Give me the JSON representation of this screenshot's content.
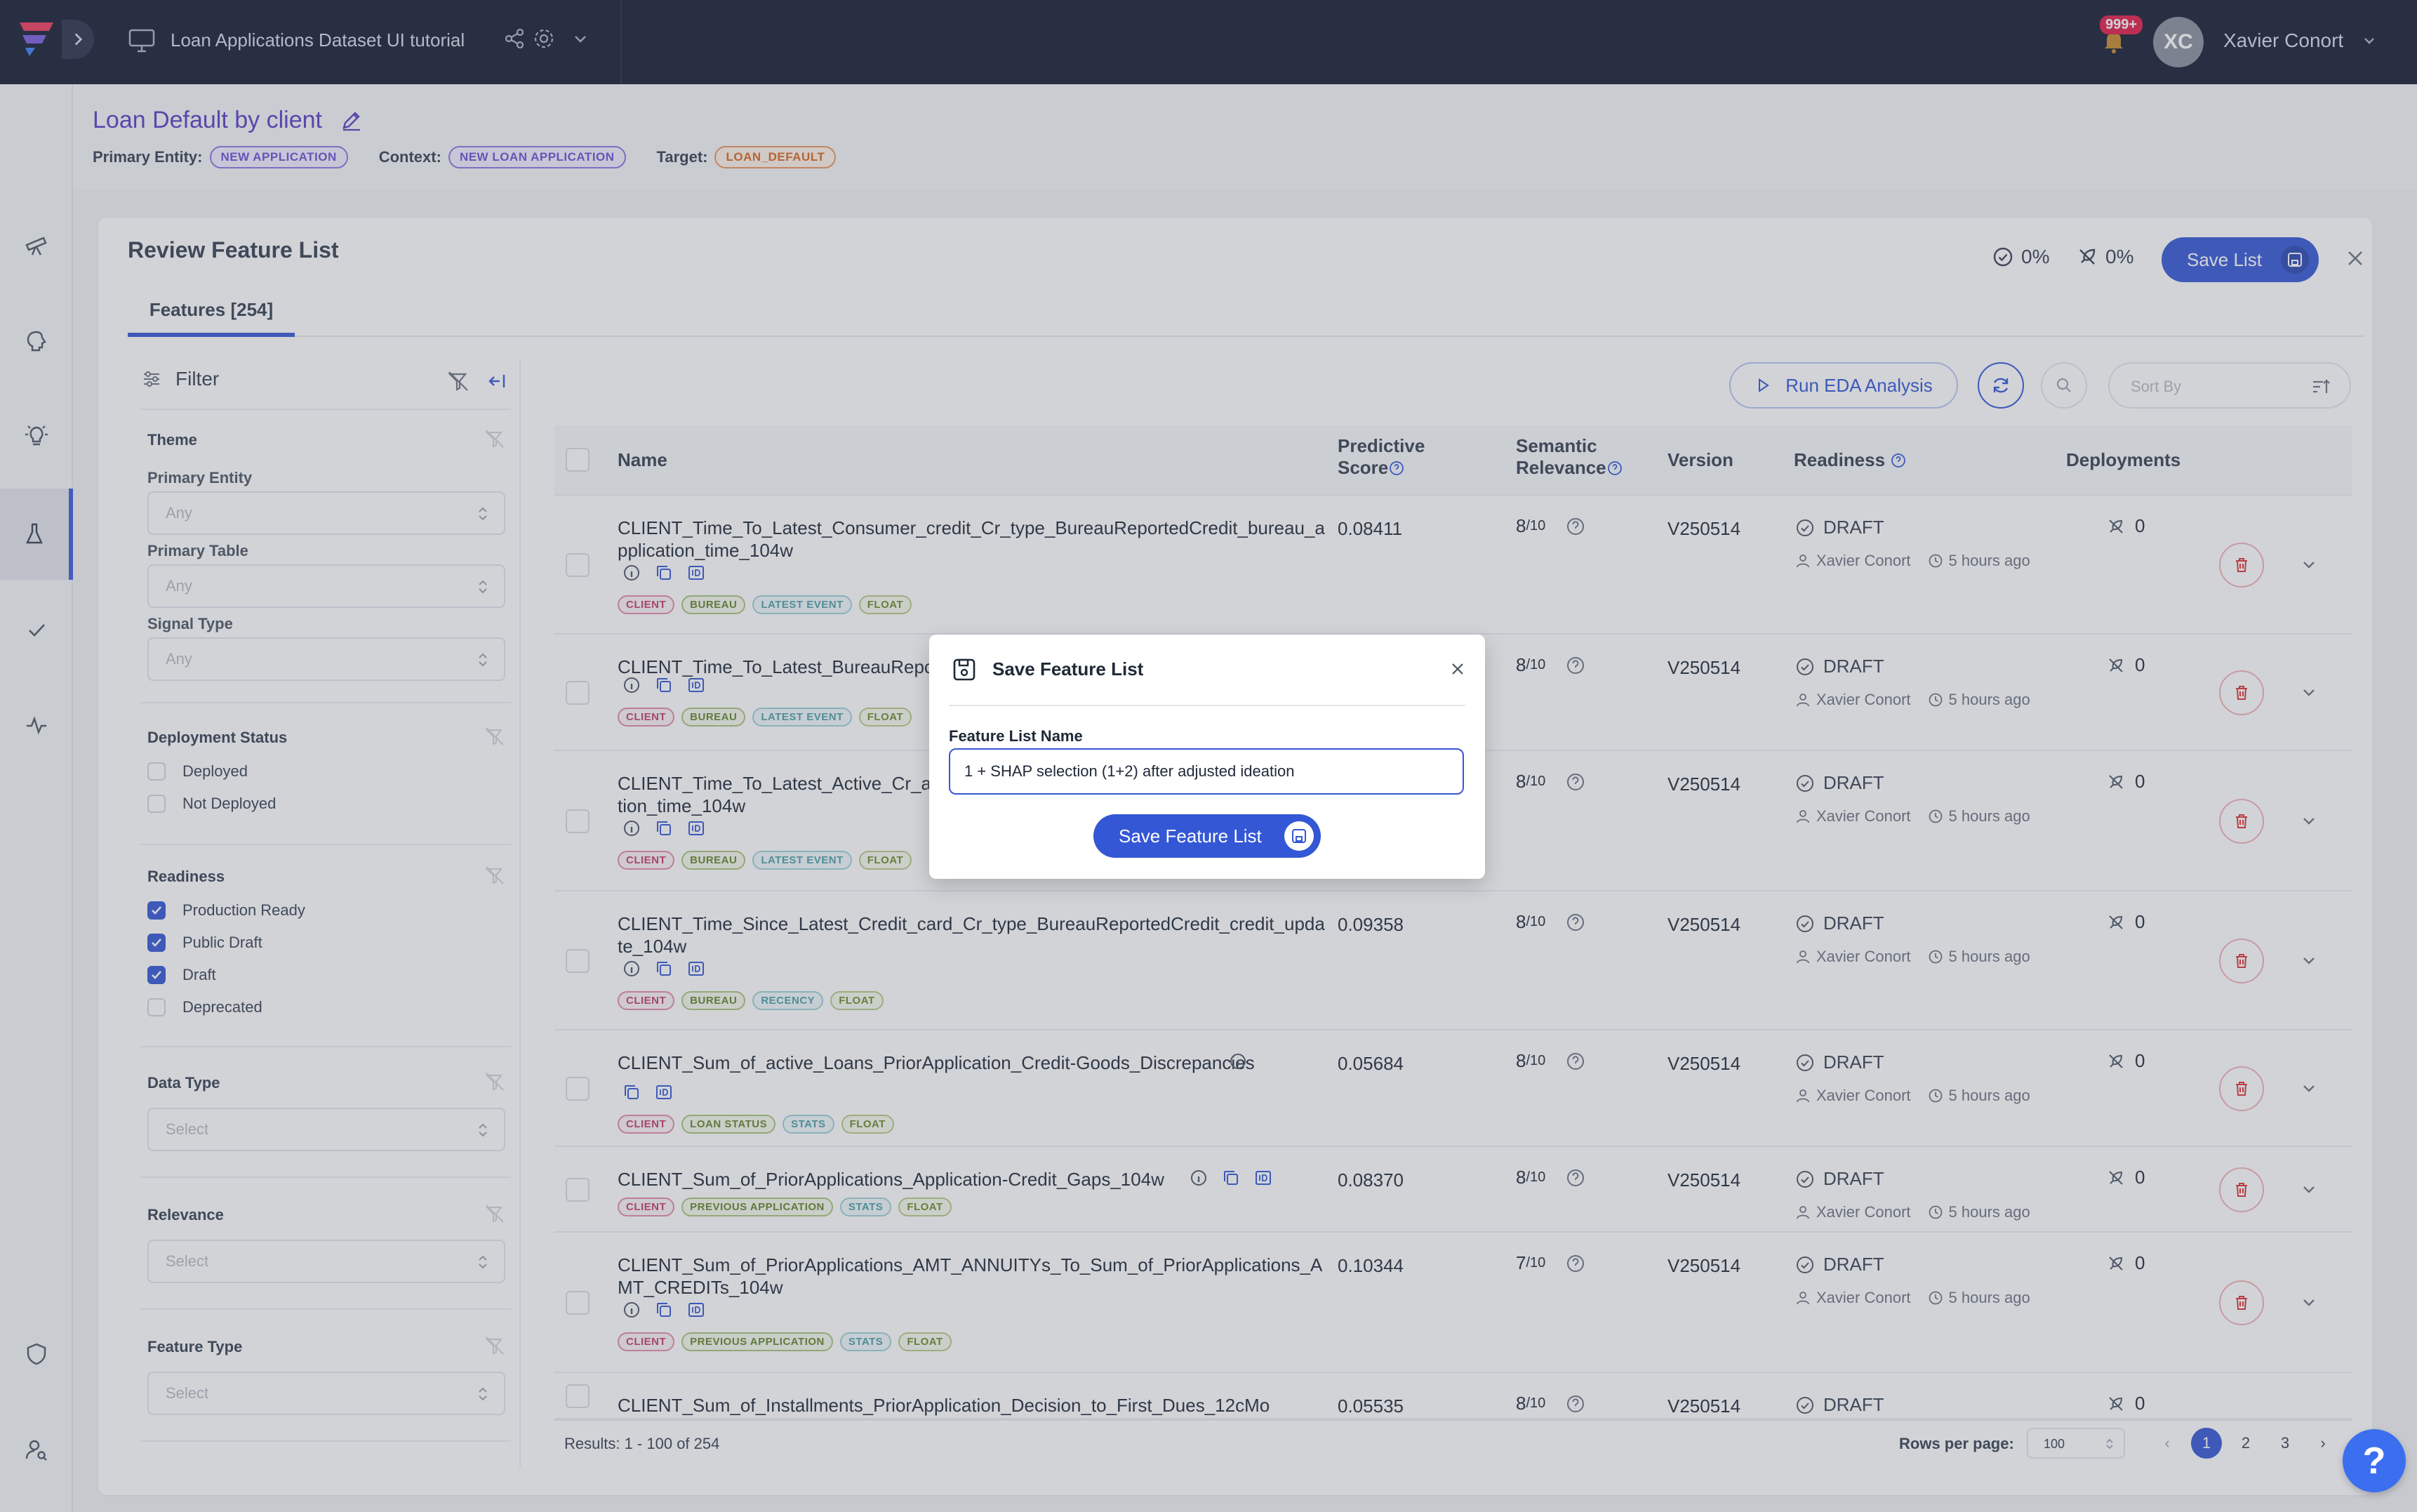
{
  "topbar": {
    "workspace_title": "Loan Applications Dataset UI tutorial",
    "notif_count": "999+",
    "avatar_initials": "XC",
    "user_name": "Xavier Conort"
  },
  "header": {
    "title": "Loan Default by client",
    "primary_entity_label": "Primary Entity:",
    "primary_entity": "NEW APPLICATION",
    "context_label": "Context:",
    "context": "NEW LOAN APPLICATION",
    "target_label": "Target:",
    "target": "LOAN_DEFAULT"
  },
  "card": {
    "title": "Review Feature List",
    "pct_ready": "0%",
    "pct_deployed": "0%",
    "save_list_label": "Save List",
    "tab_features": "Features [254]"
  },
  "filter": {
    "title": "Filter",
    "theme": "Theme",
    "primary_entity": "Primary Entity",
    "primary_table": "Primary Table",
    "signal_type": "Signal Type",
    "any": "Any",
    "deployment_status": "Deployment Status",
    "deployed": "Deployed",
    "not_deployed": "Not Deployed",
    "readiness": "Readiness",
    "production_ready": "Production Ready",
    "public_draft": "Public Draft",
    "draft": "Draft",
    "deprecated": "Deprecated",
    "data_type": "Data Type",
    "relevance": "Relevance",
    "feature_type": "Feature Type",
    "select": "Select"
  },
  "toolbar": {
    "run_eda": "Run EDA Analysis",
    "sort_by": "Sort By"
  },
  "table": {
    "col_name": "Name",
    "col_score_1": "Predictive",
    "col_score_2": "Score",
    "col_rel_1": "Semantic",
    "col_rel_2": "Relevance",
    "col_version": "Version",
    "col_readiness": "Readiness",
    "col_deployments": "Deployments",
    "rows": [
      {
        "name": "CLIENT_Time_To_Latest_Consumer_credit_Cr_type_BureauReportedCredit_bureau_application_time_104w",
        "score": "0.08411",
        "rel": "8",
        "ver": "V250514",
        "chips": [
          "CLIENT",
          "BUREAU",
          "LATEST EVENT",
          "FLOAT"
        ]
      },
      {
        "name": "CLIENT_Time_To_Latest_BureauRepc",
        "score": "",
        "rel": "8",
        "ver": "V250514",
        "chips": [
          "CLIENT",
          "BUREAU",
          "LATEST EVENT",
          "FLOAT"
        ]
      },
      {
        "name": "CLIENT_Time_To_Latest_Active_Cr_a",
        "name2": "tion_time_104w",
        "score": "",
        "rel": "8",
        "ver": "V250514",
        "chips": [
          "CLIENT",
          "BUREAU",
          "LATEST EVENT",
          "FLOAT"
        ]
      },
      {
        "name": "CLIENT_Time_Since_Latest_Credit_card_Cr_type_BureauReportedCredit_credit_update_104w",
        "score": "0.09358",
        "rel": "8",
        "ver": "V250514",
        "chips": [
          "CLIENT",
          "BUREAU",
          "RECENCY",
          "FLOAT"
        ]
      },
      {
        "name": "CLIENT_Sum_of_active_Loans_PriorApplication_Credit-Goods_Discrepancies",
        "score": "0.05684",
        "rel": "8",
        "ver": "V250514",
        "chips": [
          "CLIENT",
          "LOAN STATUS",
          "STATS",
          "FLOAT"
        ]
      },
      {
        "name": "CLIENT_Sum_of_PriorApplications_Application-Credit_Gaps_104w",
        "score": "0.08370",
        "rel": "8",
        "ver": "V250514",
        "chips": [
          "CLIENT",
          "PREVIOUS APPLICATION",
          "STATS",
          "FLOAT"
        ]
      },
      {
        "name": "CLIENT_Sum_of_PriorApplications_AMT_ANNUITYs_To_Sum_of_PriorApplications_AMT_CREDITs_104w",
        "score": "0.10344",
        "rel": "7",
        "ver": "V250514",
        "chips": [
          "CLIENT",
          "PREVIOUS APPLICATION",
          "STATS",
          "FLOAT"
        ]
      },
      {
        "name": "CLIENT_Sum_of_Installments_PriorApplication_Decision_to_First_Dues_12cMo",
        "score": "0.05535",
        "rel": "8",
        "ver": "V250514",
        "chips": []
      }
    ],
    "rel_denom": "/10",
    "readiness_value": "DRAFT",
    "author": "Xavier Conort",
    "time_ago": "5 hours ago",
    "deployments": "0"
  },
  "footer": {
    "results": "Results: 1 - 100 of 254",
    "rows_per_page_label": "Rows per page:",
    "rows_per_page": "100",
    "pages": [
      "1",
      "2",
      "3"
    ]
  },
  "help": "?",
  "modal": {
    "title": "Save Feature List",
    "label": "Feature List Name",
    "input_value": "1 + SHAP selection (1+2) after adjusted ideation",
    "save_button": "Save Feature List"
  },
  "colors": {
    "topbar": "#151c33",
    "accent": "#3457d5",
    "title": "#5b3cc4"
  }
}
